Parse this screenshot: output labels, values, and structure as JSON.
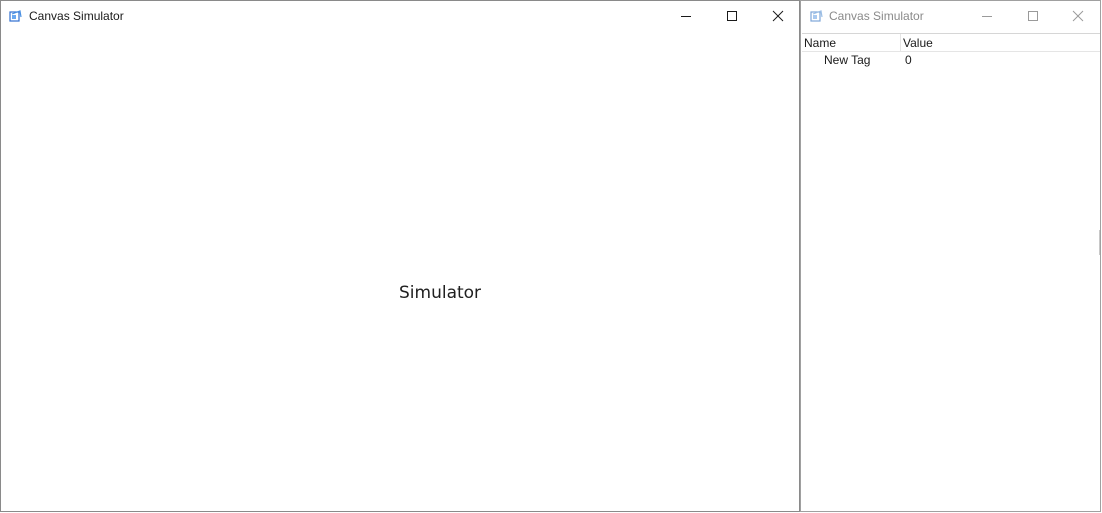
{
  "main_window": {
    "title": "Canvas Simulator",
    "canvas_text": "Simulator"
  },
  "tag_window": {
    "title": "Canvas Simulator",
    "columns": {
      "name": "Name",
      "value": "Value"
    },
    "rows": [
      {
        "name": "New Tag",
        "value": "0"
      }
    ]
  },
  "icons": {
    "app": "app-icon",
    "minimize": "minimize-icon",
    "maximize": "maximize-icon",
    "close": "close-icon"
  },
  "colors": {
    "title_active": "#1a1a1a",
    "title_inactive": "#8a8a8a",
    "app_icon_blue": "#2f6fd0"
  }
}
